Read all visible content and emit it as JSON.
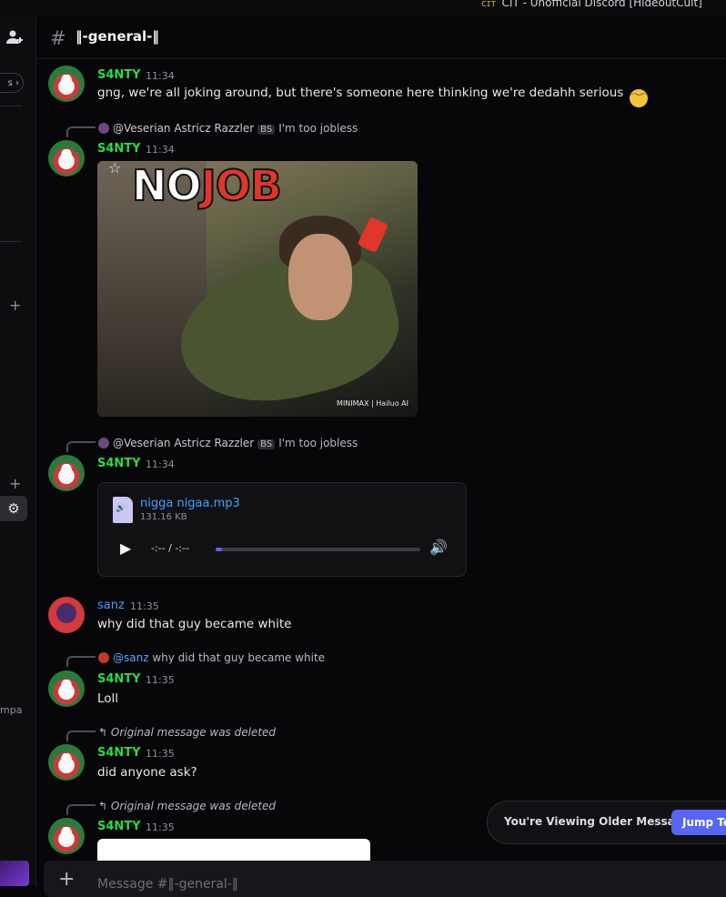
{
  "window": {
    "title": "CIT - Unofficial Discord [HideoutCult]"
  },
  "sidebar": {
    "chip_label": "s",
    "truncated_text": "mpa"
  },
  "channel": {
    "hash": "#",
    "name": "‖-general-‖"
  },
  "messages": [
    {
      "author": "S4NTY",
      "time": "11:34",
      "text": "gng, we're all joking around, but there's someone here thinking we're dedahh serious",
      "emoji": "pensive-face"
    },
    {
      "reply": {
        "author": "@Veserian Astricz Razzler",
        "tag": "BS",
        "text": "I'm too jobless"
      },
      "author": "S4NTY",
      "time": "11:34",
      "gif": {
        "caption_white": "NO",
        "caption_red": "JOB",
        "watermark": "MINIMAX | Hailuo AI"
      }
    },
    {
      "reply": {
        "author": "@Veserian Astricz Razzler",
        "tag": "BS",
        "text": "I'm too jobless"
      },
      "author": "S4NTY",
      "time": "11:34",
      "attachment": {
        "filename": "nigga nigaa.mp3",
        "size": "131.16 KB",
        "time_display": "-:-- / -:--",
        "progress": 0.03
      }
    },
    {
      "author": "sanz",
      "time": "11:35",
      "text": "why did that guy became white"
    },
    {
      "reply": {
        "author": "@sanz",
        "text": "why did that guy became white"
      },
      "author": "S4NTY",
      "time": "11:35",
      "text": "Loll"
    },
    {
      "reply": {
        "deleted": "Original message was deleted"
      },
      "author": "S4NTY",
      "time": "11:35",
      "text": "did anyone ask?"
    },
    {
      "reply": {
        "deleted": "Original message was deleted"
      },
      "author": "S4NTY",
      "time": "11:35"
    }
  ],
  "older_banner": {
    "label": "You're Viewing Older Messages",
    "button": "Jump To"
  },
  "composer": {
    "placeholder": "Message #‖-general-‖"
  },
  "colors": {
    "username_green": "#2dd84a",
    "mention_blue": "#3ca4ff",
    "accent": "#5865f2"
  }
}
